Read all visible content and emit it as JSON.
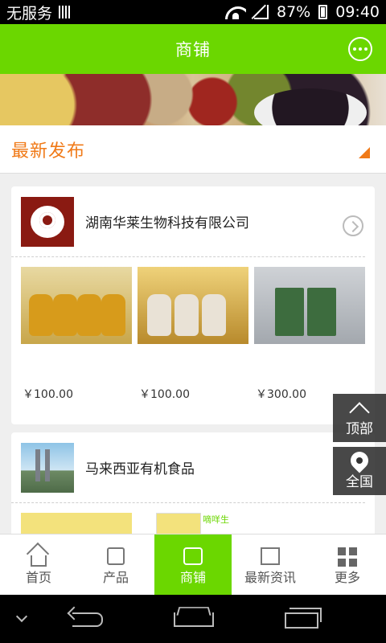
{
  "status_bar": {
    "carrier": "无服务",
    "battery": "87%",
    "time": "09:40",
    "icons": [
      "sim-icon",
      "wifi-icon",
      "signal-icon",
      "battery-icon"
    ]
  },
  "header": {
    "title": "商铺",
    "right_icon": "chat-icon"
  },
  "section": {
    "title": "最新发布",
    "corner_icon": "corner-arrow-icon"
  },
  "shops": [
    {
      "name": "湖南华莱生物科技有限公司",
      "products": [
        {
          "price": "￥100.00"
        },
        {
          "price": "￥100.00"
        },
        {
          "price": "￥300.00"
        }
      ]
    },
    {
      "name": "马来西亚有机食品",
      "thumb_label": "嘀咩生"
    }
  ],
  "float_buttons": {
    "top": "顶部",
    "all": "全国"
  },
  "bottom_nav": [
    {
      "label": "首页",
      "icon": "home-icon"
    },
    {
      "label": "产品",
      "icon": "shirt-icon"
    },
    {
      "label": "商铺",
      "icon": "shop-icon",
      "active": true
    },
    {
      "label": "最新资讯",
      "icon": "news-icon"
    },
    {
      "label": "更多",
      "icon": "grid-icon"
    }
  ],
  "colors": {
    "brand_green": "#6bd700",
    "accent_orange": "#f07a18"
  }
}
